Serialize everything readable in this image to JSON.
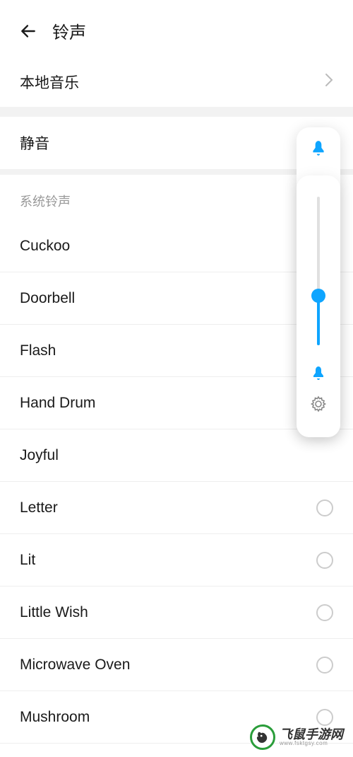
{
  "header": {
    "title": "铃声"
  },
  "localMusic": {
    "label": "本地音乐"
  },
  "mute": {
    "label": "静音"
  },
  "systemSection": {
    "header": "系统铃声"
  },
  "ringtones": [
    {
      "name": "Cuckoo",
      "showRadio": false
    },
    {
      "name": "Doorbell",
      "showRadio": false
    },
    {
      "name": "Flash",
      "showRadio": false
    },
    {
      "name": "Hand Drum",
      "showRadio": false
    },
    {
      "name": "Joyful",
      "showRadio": false
    },
    {
      "name": "Letter",
      "showRadio": true
    },
    {
      "name": "Lit",
      "showRadio": true
    },
    {
      "name": "Little Wish",
      "showRadio": true
    },
    {
      "name": "Microwave Oven",
      "showRadio": true
    },
    {
      "name": "Mushroom",
      "showRadio": true
    }
  ],
  "volume": {
    "percent": 30
  },
  "colors": {
    "accent": "#0ea5ff",
    "brand": "#2a9d3a"
  },
  "watermark": {
    "main": "飞鼠手游网",
    "sub": "www.fsktgsy.com"
  }
}
